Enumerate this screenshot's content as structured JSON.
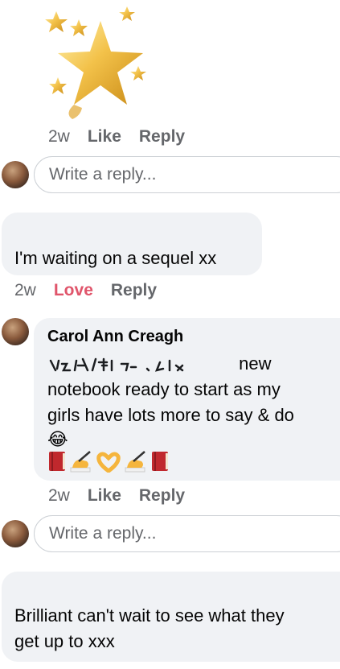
{
  "comment1": {
    "sticker": "gold-stars-sticker",
    "time": "2w",
    "like_label": "Like",
    "reply_label": "Reply"
  },
  "reply_input_1": {
    "placeholder": "Write a reply..."
  },
  "comment2": {
    "text": "I'm waiting on a sequel xx",
    "time": "2w",
    "reaction_label": "Love",
    "reaction_color": "#e0556b",
    "reply_label": "Reply"
  },
  "comment3": {
    "author": "Carol Ann Creagh",
    "line1_end": "new",
    "line2": "notebook ready to start as my",
    "line3": "girls have lots more to say & do",
    "emoji_line": "😂",
    "emoji_icons": [
      "book-icon",
      "writing-hand-icon",
      "heart-hands-icon",
      "writing-hand-icon",
      "book-icon"
    ],
    "time": "2w",
    "like_label": "Like",
    "reply_label": "Reply"
  },
  "reply_input_2": {
    "placeholder": "Write a reply..."
  },
  "comment4": {
    "line1": "Brilliant can't wait to see what they",
    "line2": "get up to xxx"
  },
  "colors": {
    "bubble": "#f0f2f5",
    "meta": "#65676b",
    "love": "#e0556b"
  }
}
